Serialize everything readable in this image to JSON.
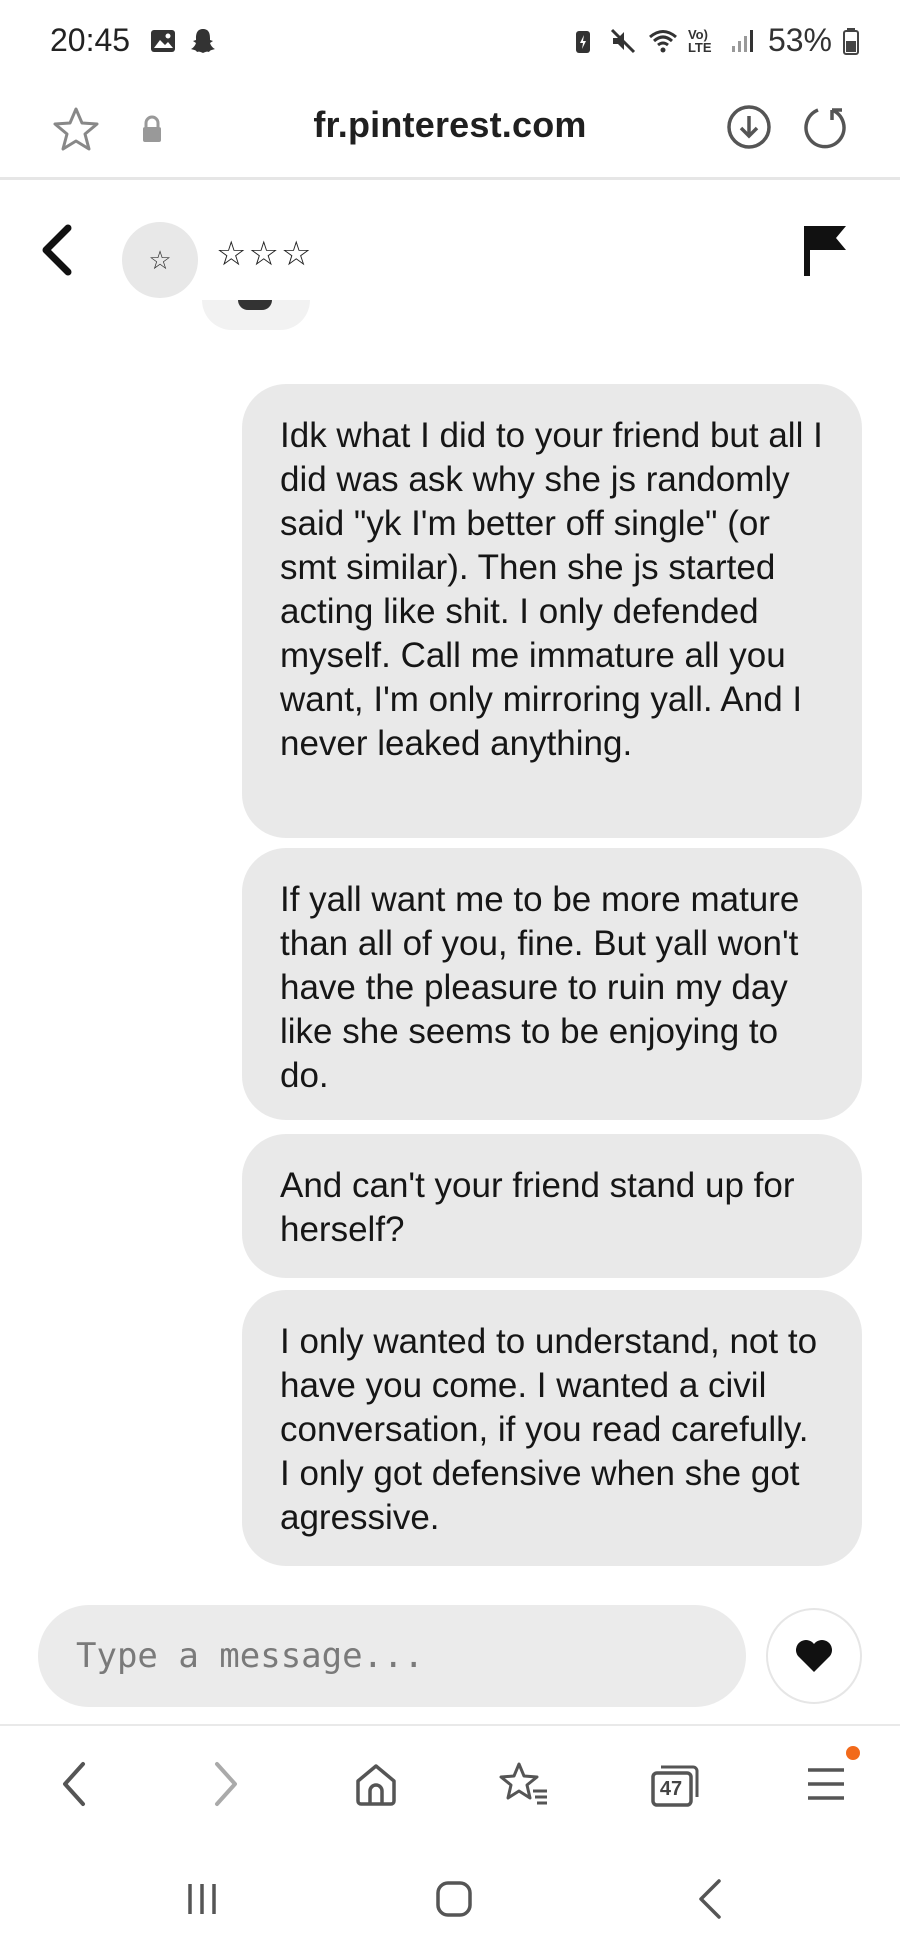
{
  "status_bar": {
    "time": "20:45",
    "network": "Vo) LTE",
    "battery": "53%",
    "icons": [
      "gallery-icon",
      "snapchat-icon",
      "battery-saver-icon",
      "mute-icon",
      "wifi-icon",
      "signal-icon",
      "battery-icon"
    ]
  },
  "browser": {
    "url": "fr.pinterest.com",
    "tab_count": "47"
  },
  "chat": {
    "avatar_glyph": "☆",
    "name": "☆☆☆",
    "messages": [
      {
        "text": "Idk what I did to your friend but all I did was ask why she js randomly said \"yk I'm better off single\" (or smt similar). Then she js started acting like shit. I only defended myself. Call me immature all you want, I'm only mirroring yall. And I never leaked anything."
      },
      {
        "text": "If yall want me to be more mature than all of you, fine. But yall won't have the pleasure to ruin my day like she seems to be enjoying to do."
      },
      {
        "text": "And can't your friend stand up for herself?"
      },
      {
        "text": "I only wanted to understand, not to have you come. I wanted a civil conversation, if you read carefully. I only got defensive when she got agressive."
      }
    ],
    "input_placeholder": "Type a message..."
  },
  "colors": {
    "bubble_bg": "#e9e9e9",
    "notification_dot": "#f26a1b"
  }
}
